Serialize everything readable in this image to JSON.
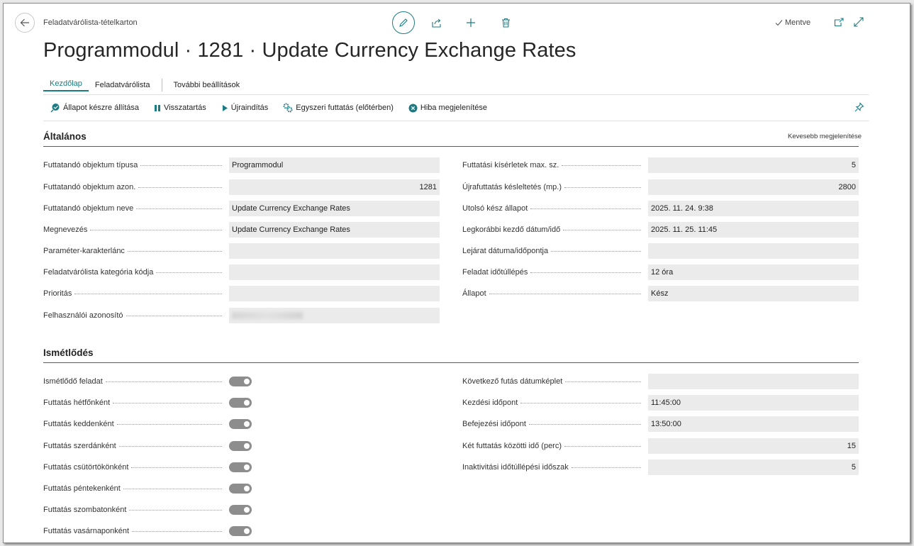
{
  "breadcrumb": "Feladatvárólista-tételkarton",
  "status": {
    "saved_label": "Mentve"
  },
  "title": "Programmodul · 1281 · Update Currency Exchange Rates",
  "tabs": [
    "Kezdőlap",
    "Feladatvárólista",
    "További beállítások"
  ],
  "actions": [
    "Állapot készre állítása",
    "Visszatartás",
    "Újraindítás",
    "Egyszeri futtatás (előtérben)",
    "Hiba megjelenítése"
  ],
  "general": {
    "title": "Általános",
    "show_less": "Kevesebb megjelenítése",
    "left": [
      {
        "label": "Futtatandó objektum típusa",
        "value": "Programmodul"
      },
      {
        "label": "Futtatandó objektum azon.",
        "value": "1281"
      },
      {
        "label": "Futtatandó objektum neve",
        "value": "Update Currency Exchange Rates"
      },
      {
        "label": "Megnevezés",
        "value": "Update Currency Exchange Rates"
      },
      {
        "label": "Paraméter-karakterlánc",
        "value": ""
      },
      {
        "label": "Feladatvárólista kategória kódja",
        "value": ""
      },
      {
        "label": "Prioritás",
        "value": ""
      },
      {
        "label": "Felhasználói azonosító",
        "value": ""
      }
    ],
    "right": [
      {
        "label": "Futtatási kísérletek max. sz.",
        "value": "5"
      },
      {
        "label": "Újrafuttatás késleltetés (mp.)",
        "value": "2800"
      },
      {
        "label": "Utolsó kész állapot",
        "value": "2025. 11. 24. 9:38"
      },
      {
        "label": "Legkorábbi kezdő dátum/idő",
        "value": "2025. 11. 25. 11:45"
      },
      {
        "label": "Lejárat dátuma/időpontja",
        "value": ""
      },
      {
        "label": "Feladat időtúllépés",
        "value": "12 óra"
      },
      {
        "label": "Állapot",
        "value": "Kész"
      }
    ]
  },
  "recurrence": {
    "title": "Ismétlődés",
    "left": [
      {
        "label": "Ismétlődő feladat",
        "on": true
      },
      {
        "label": "Futtatás hétfőnként",
        "on": true
      },
      {
        "label": "Futtatás keddenként",
        "on": true
      },
      {
        "label": "Futtatás szerdánként",
        "on": true
      },
      {
        "label": "Futtatás csütörtökönként",
        "on": true
      },
      {
        "label": "Futtatás péntekenként",
        "on": true
      },
      {
        "label": "Futtatás szombatonként",
        "on": true
      },
      {
        "label": "Futtatás vasárnaponként",
        "on": true
      }
    ],
    "right": [
      {
        "label": "Következő futás dátumképlet",
        "value": ""
      },
      {
        "label": "Kezdési időpont",
        "value": "11:45:00"
      },
      {
        "label": "Befejezési időpont",
        "value": "13:50:00"
      },
      {
        "label": "Két futtatás közötti idő (perc)",
        "value": "15"
      },
      {
        "label": "Inaktivitási időtúllépési időszak",
        "value": "5"
      }
    ]
  }
}
